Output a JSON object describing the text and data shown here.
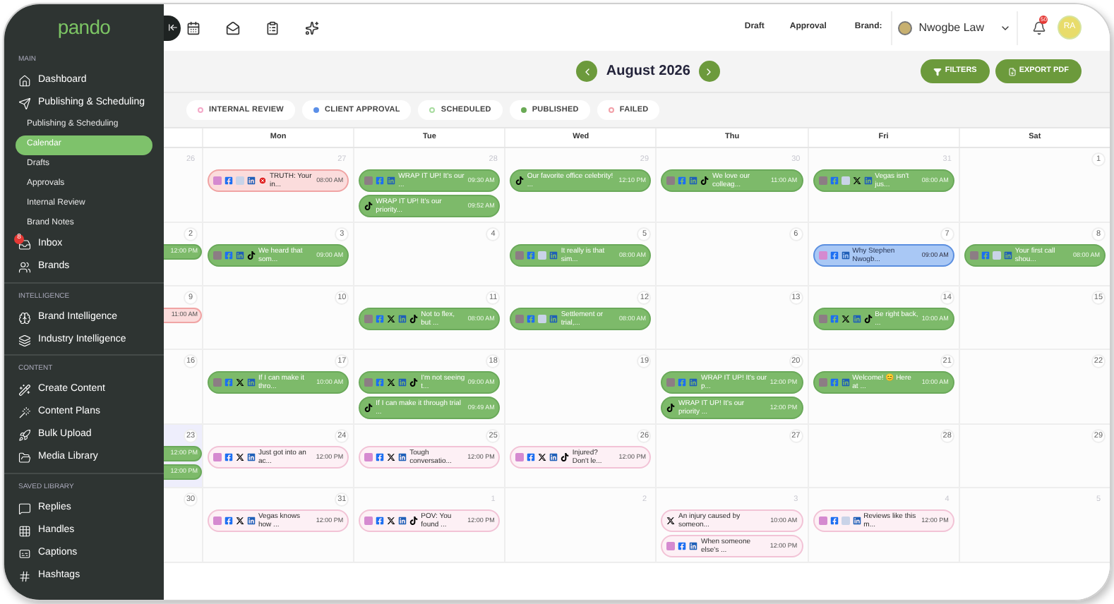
{
  "sidebar": {
    "logo": "pando",
    "sections": [
      {
        "title": "MAIN",
        "items": [
          {
            "label": "Dashboard",
            "kind": "main",
            "selected": false
          },
          {
            "label": "Publishing & Scheduling",
            "kind": "main",
            "selected": false
          },
          {
            "label": "Publishing & Scheduling",
            "kind": "sub",
            "selected": false
          },
          {
            "label": "Calendar",
            "kind": "sub",
            "selected": true
          },
          {
            "label": "Drafts",
            "kind": "sub",
            "selected": false
          },
          {
            "label": "Approvals",
            "kind": "sub",
            "selected": false
          },
          {
            "label": "Internal Review",
            "kind": "sub",
            "selected": false
          },
          {
            "label": "Brand Notes",
            "kind": "sub",
            "selected": false
          },
          {
            "label": "Inbox",
            "kind": "main",
            "selected": false,
            "badge": "8"
          },
          {
            "label": "Brands",
            "kind": "main",
            "selected": false
          }
        ]
      },
      {
        "title": "INTELLIGENCE",
        "items": [
          {
            "label": "Brand Intelligence",
            "kind": "main",
            "selected": false
          },
          {
            "label": "Industry Intelligence",
            "kind": "main",
            "selected": false
          }
        ]
      },
      {
        "title": "CONTENT",
        "items": [
          {
            "label": "Create Content",
            "kind": "main",
            "selected": false
          },
          {
            "label": "Content Plans",
            "kind": "main",
            "selected": false
          },
          {
            "label": "Bulk Upload",
            "kind": "main",
            "selected": false
          },
          {
            "label": "Media Library",
            "kind": "main",
            "selected": false
          }
        ]
      },
      {
        "title": "SAVED LIBRARY",
        "items": [
          {
            "label": "Replies",
            "kind": "main",
            "selected": false
          },
          {
            "label": "Handles",
            "kind": "main",
            "selected": false
          },
          {
            "label": "Captions",
            "kind": "main",
            "selected": false
          },
          {
            "label": "Hashtags",
            "kind": "main",
            "selected": false
          }
        ]
      }
    ]
  },
  "topbar": {
    "links": [
      "Draft",
      "Approval"
    ],
    "brand_label": "Brand:",
    "brand": "Nwogbe Law",
    "notifications": "50",
    "user_initials": "RA"
  },
  "header": {
    "month": "August 2026",
    "buttons": [
      "FILTERS",
      "EXPORT PDF"
    ]
  },
  "legend": [
    {
      "label": "INTERNAL REVIEW",
      "color": "#f4a9c8",
      "hollow": true
    },
    {
      "label": "CLIENT APPROVAL",
      "color": "#5b8fe8",
      "hollow": false
    },
    {
      "label": "SCHEDULED",
      "color": "#a8dca0",
      "hollow": true
    },
    {
      "label": "PUBLISHED",
      "color": "#6aaa55",
      "hollow": false
    },
    {
      "label": "FAILED",
      "color": "#f2a0a8",
      "hollow": true
    }
  ],
  "weekdays": [
    "Mon",
    "Tue",
    "Wed",
    "Thu",
    "Fri",
    "Sat"
  ],
  "weeks": [
    {
      "days": [
        {
          "day": "26",
          "muted": true,
          "today": false
        },
        {
          "day": "27",
          "muted": true,
          "today": false,
          "posts": [
            {
              "kind": "failed",
              "platforms": [
                {
                  "kind": "ig"
                },
                {
                  "kind": "fb"
                },
                {
                  "kind": "gb"
                },
                {
                  "kind": "in"
                },
                {
                  "kind": "err"
                }
              ],
              "text": "TRUTH: Your in...",
              "time": "08:00 AM"
            }
          ]
        },
        {
          "day": "28",
          "muted": true,
          "today": false,
          "posts": [
            {
              "kind": "published",
              "platforms": [
                {
                  "kind": "ig"
                },
                {
                  "kind": "fb"
                },
                {
                  "kind": "in"
                }
              ],
              "text": "WRAP IT UP! It's our ...",
              "time": "09:30 AM"
            },
            {
              "kind": "published",
              "platforms": [
                {
                  "kind": "tt"
                }
              ],
              "text": "WRAP IT UP! It's our priority...",
              "time": "09:52 AM"
            }
          ]
        },
        {
          "day": "29",
          "muted": true,
          "today": false,
          "posts": [
            {
              "kind": "published",
              "platforms": [
                {
                  "kind": "tt"
                }
              ],
              "text": "Our favorite office celebrity! ...",
              "time": "12:10 PM"
            }
          ]
        },
        {
          "day": "30",
          "muted": true,
          "today": false,
          "posts": [
            {
              "kind": "published",
              "platforms": [
                {
                  "kind": "ig"
                },
                {
                  "kind": "fb"
                },
                {
                  "kind": "in"
                },
                {
                  "kind": "tt"
                }
              ],
              "text": "We love our colleag...",
              "time": "11:00 AM"
            }
          ]
        },
        {
          "day": "31",
          "muted": true,
          "today": false,
          "posts": [
            {
              "kind": "published",
              "platforms": [
                {
                  "kind": "ig"
                },
                {
                  "kind": "fb"
                },
                {
                  "kind": "gb"
                },
                {
                  "kind": "x"
                },
                {
                  "kind": "in"
                }
              ],
              "text": "Vegas isn't jus...",
              "time": "08:00 AM"
            }
          ]
        },
        {
          "day": "1",
          "muted": false,
          "today": false
        }
      ]
    },
    {
      "days": [
        {
          "day": "2",
          "muted": false,
          "today": false,
          "posts": [
            {
              "kind": "published",
              "time": "12:00 PM"
            }
          ]
        },
        {
          "day": "3",
          "muted": false,
          "today": false,
          "posts": [
            {
              "kind": "published",
              "platforms": [
                {
                  "kind": "ig"
                },
                {
                  "kind": "fb"
                },
                {
                  "kind": "in"
                },
                {
                  "kind": "tt"
                }
              ],
              "text": "We heard that som...",
              "time": "09:00 AM"
            }
          ]
        },
        {
          "day": "4",
          "muted": false,
          "today": false
        },
        {
          "day": "5",
          "muted": false,
          "today": false,
          "posts": [
            {
              "kind": "published",
              "platforms": [
                {
                  "kind": "ig"
                },
                {
                  "kind": "fb"
                },
                {
                  "kind": "gb"
                },
                {
                  "kind": "in"
                }
              ],
              "text": "It really is that sim...",
              "time": "08:00 AM"
            }
          ]
        },
        {
          "day": "6",
          "muted": false,
          "today": false
        },
        {
          "day": "7",
          "muted": false,
          "today": false,
          "posts": [
            {
              "kind": "approval",
              "platforms": [
                {
                  "kind": "ig"
                },
                {
                  "kind": "fb"
                },
                {
                  "kind": "in"
                }
              ],
              "text": "Why Stephen Nwogb...",
              "time": "09:00 AM"
            }
          ]
        },
        {
          "day": "8",
          "muted": false,
          "today": false,
          "posts": [
            {
              "kind": "published",
              "platforms": [
                {
                  "kind": "ig"
                },
                {
                  "kind": "fb"
                },
                {
                  "kind": "gb"
                },
                {
                  "kind": "in"
                }
              ],
              "text": "Your first call shou...",
              "time": "08:00 AM"
            }
          ]
        }
      ]
    },
    {
      "days": [
        {
          "day": "9",
          "muted": false,
          "today": false,
          "posts": [
            {
              "kind": "failed",
              "time": "11:00 AM"
            }
          ]
        },
        {
          "day": "10",
          "muted": false,
          "today": false
        },
        {
          "day": "11",
          "muted": false,
          "today": false,
          "posts": [
            {
              "kind": "published",
              "platforms": [
                {
                  "kind": "ig"
                },
                {
                  "kind": "fb"
                },
                {
                  "kind": "x"
                },
                {
                  "kind": "in"
                },
                {
                  "kind": "tt"
                }
              ],
              "text": "Not to flex, but ...",
              "time": "08:00 AM"
            }
          ]
        },
        {
          "day": "12",
          "muted": false,
          "today": false,
          "posts": [
            {
              "kind": "published",
              "platforms": [
                {
                  "kind": "ig"
                },
                {
                  "kind": "fb"
                },
                {
                  "kind": "gb"
                },
                {
                  "kind": "in"
                }
              ],
              "text": "Settlement or trial,...",
              "time": "08:00 AM"
            }
          ]
        },
        {
          "day": "13",
          "muted": false,
          "today": false
        },
        {
          "day": "14",
          "muted": false,
          "today": false,
          "posts": [
            {
              "kind": "published",
              "platforms": [
                {
                  "kind": "ig"
                },
                {
                  "kind": "fb"
                },
                {
                  "kind": "x"
                },
                {
                  "kind": "in"
                },
                {
                  "kind": "tt"
                }
              ],
              "text": "Be right back, ...",
              "time": "10:00 AM"
            }
          ]
        },
        {
          "day": "15",
          "muted": false,
          "today": false
        }
      ]
    },
    {
      "days": [
        {
          "day": "16",
          "muted": false,
          "today": false
        },
        {
          "day": "17",
          "muted": false,
          "today": false,
          "posts": [
            {
              "kind": "published",
              "platforms": [
                {
                  "kind": "ig"
                },
                {
                  "kind": "fb"
                },
                {
                  "kind": "x"
                },
                {
                  "kind": "in"
                }
              ],
              "text": "If I can make it thro...",
              "time": "10:00 AM"
            }
          ]
        },
        {
          "day": "18",
          "muted": false,
          "today": false,
          "posts": [
            {
              "kind": "published",
              "platforms": [
                {
                  "kind": "ig"
                },
                {
                  "kind": "fb"
                },
                {
                  "kind": "x"
                },
                {
                  "kind": "in"
                },
                {
                  "kind": "tt"
                }
              ],
              "text": "I'm not seeing t...",
              "time": "09:00 AM"
            },
            {
              "kind": "published",
              "platforms": [
                {
                  "kind": "tt"
                }
              ],
              "text": "If I can make it through trial ...",
              "time": "09:49 AM"
            }
          ]
        },
        {
          "day": "19",
          "muted": false,
          "today": false
        },
        {
          "day": "20",
          "muted": false,
          "today": false,
          "posts": [
            {
              "kind": "published",
              "platforms": [
                {
                  "kind": "ig"
                },
                {
                  "kind": "fb"
                },
                {
                  "kind": "in"
                }
              ],
              "text": "WRAP IT UP! It's our p...",
              "time": "12:00 PM"
            },
            {
              "kind": "published",
              "platforms": [
                {
                  "kind": "tt"
                }
              ],
              "text": "WRAP IT UP! It's our priority ...",
              "time": "12:00 PM"
            }
          ]
        },
        {
          "day": "21",
          "muted": false,
          "today": false,
          "posts": [
            {
              "kind": "published",
              "platforms": [
                {
                  "kind": "ig"
                },
                {
                  "kind": "fb"
                },
                {
                  "kind": "in"
                }
              ],
              "text": "Welcome! 😊 Here at ...",
              "time": "10:00 AM"
            }
          ]
        },
        {
          "day": "22",
          "muted": false,
          "today": false
        }
      ]
    },
    {
      "days": [
        {
          "day": "23",
          "muted": false,
          "today": true,
          "posts": [
            {
              "kind": "published",
              "time": "12:00 PM"
            },
            {
              "kind": "published",
              "time": "12:00 PM"
            }
          ]
        },
        {
          "day": "24",
          "muted": false,
          "today": false,
          "posts": [
            {
              "kind": "review",
              "platforms": [
                {
                  "kind": "ig"
                },
                {
                  "kind": "fb"
                },
                {
                  "kind": "x"
                },
                {
                  "kind": "in"
                }
              ],
              "text": "Just got into an ac...",
              "time": "12:00 PM"
            }
          ]
        },
        {
          "day": "25",
          "muted": false,
          "today": false,
          "posts": [
            {
              "kind": "review",
              "platforms": [
                {
                  "kind": "ig"
                },
                {
                  "kind": "fb"
                },
                {
                  "kind": "x"
                },
                {
                  "kind": "in"
                }
              ],
              "text": "Tough conversatio...",
              "time": "12:00 PM"
            }
          ]
        },
        {
          "day": "26",
          "muted": false,
          "today": false,
          "posts": [
            {
              "kind": "review",
              "platforms": [
                {
                  "kind": "ig"
                },
                {
                  "kind": "fb"
                },
                {
                  "kind": "x"
                },
                {
                  "kind": "in"
                },
                {
                  "kind": "tt"
                }
              ],
              "text": "Injured? Don't le...",
              "time": "12:00 PM"
            }
          ]
        },
        {
          "day": "27",
          "muted": false,
          "today": false
        },
        {
          "day": "28",
          "muted": false,
          "today": false
        },
        {
          "day": "29",
          "muted": false,
          "today": false
        }
      ]
    },
    {
      "days": [
        {
          "day": "30",
          "muted": false,
          "today": false
        },
        {
          "day": "31",
          "muted": false,
          "today": false,
          "posts": [
            {
              "kind": "review",
              "platforms": [
                {
                  "kind": "ig"
                },
                {
                  "kind": "fb"
                },
                {
                  "kind": "x"
                },
                {
                  "kind": "in"
                }
              ],
              "text": "Vegas knows how ...",
              "time": "12:00 PM"
            }
          ]
        },
        {
          "day": "1",
          "muted": true,
          "today": false,
          "posts": [
            {
              "kind": "review",
              "platforms": [
                {
                  "kind": "ig"
                },
                {
                  "kind": "fb"
                },
                {
                  "kind": "x"
                },
                {
                  "kind": "in"
                },
                {
                  "kind": "tt"
                }
              ],
              "text": "POV: You found ...",
              "time": "12:00 PM"
            }
          ]
        },
        {
          "day": "2",
          "muted": true,
          "today": false
        },
        {
          "day": "3",
          "muted": true,
          "today": false,
          "posts": [
            {
              "kind": "review",
              "platforms": [
                {
                  "kind": "x"
                }
              ],
              "text": "An injury caused by someon...",
              "time": "10:00 AM"
            },
            {
              "kind": "review",
              "platforms": [
                {
                  "kind": "ig"
                },
                {
                  "kind": "fb"
                },
                {
                  "kind": "in"
                }
              ],
              "text": "When someone else's ...",
              "time": "12:00 PM"
            }
          ]
        },
        {
          "day": "4",
          "muted": true,
          "today": false,
          "posts": [
            {
              "kind": "review",
              "platforms": [
                {
                  "kind": "ig"
                },
                {
                  "kind": "fb"
                },
                {
                  "kind": "gb"
                },
                {
                  "kind": "in"
                }
              ],
              "text": "Reviews like this m...",
              "time": "12:00 PM"
            }
          ]
        },
        {
          "day": "5",
          "muted": true,
          "today": false
        }
      ]
    }
  ]
}
